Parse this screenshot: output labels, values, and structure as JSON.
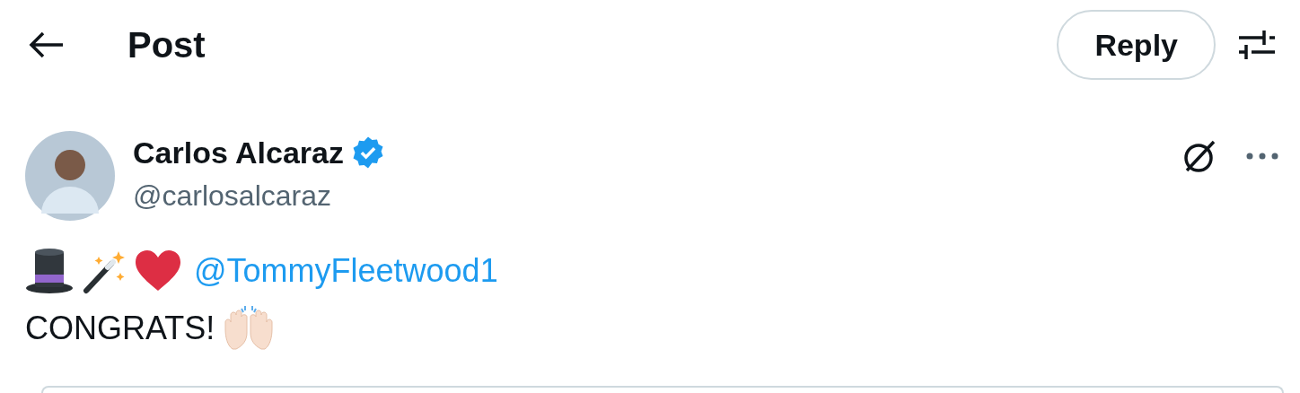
{
  "header": {
    "title": "Post",
    "reply_button": "Reply"
  },
  "author": {
    "name": "Carlos Alcaraz",
    "handle": "@carlosalcaraz",
    "verified": true
  },
  "post": {
    "mention": "@TommyFleetwood1",
    "text": "CONGRATS!"
  }
}
